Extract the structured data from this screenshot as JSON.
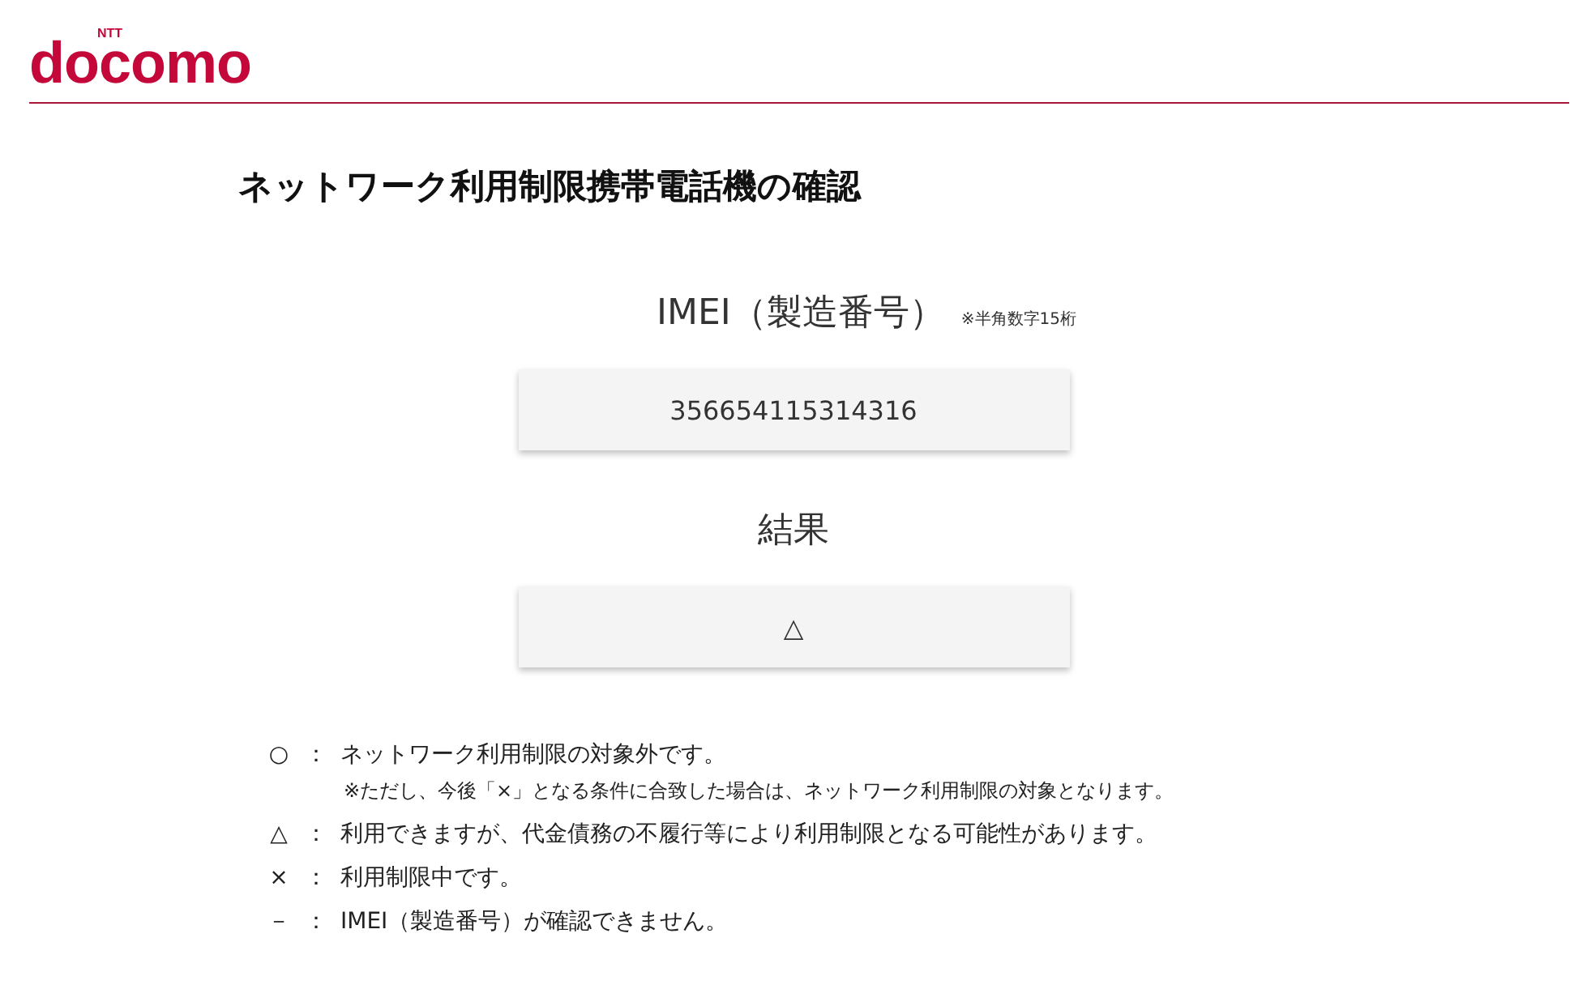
{
  "logo": {
    "small": "NTT",
    "brand": "docomo"
  },
  "title": "ネットワーク利用制限携帯電話機の確認",
  "imei": {
    "label": "IMEI（製造番号）",
    "note": "※半角数字15桁",
    "value": "356654115314316"
  },
  "result": {
    "label": "結果",
    "value": "△"
  },
  "legend": [
    {
      "symbol": "○",
      "colon": "：",
      "text": "ネットワーク利用制限の対象外です。",
      "note": "※ただし、今後「×」となる条件に合致した場合は、ネットワーク利用制限の対象となります。"
    },
    {
      "symbol": "△",
      "colon": "：",
      "text": "利用できますが、代金債務の不履行等により利用制限となる可能性があります。"
    },
    {
      "symbol": "×",
      "colon": "：",
      "text": "利用制限中です。"
    },
    {
      "symbol": "－",
      "colon": "：",
      "text": "IMEI（製造番号）が確認できません。"
    }
  ]
}
